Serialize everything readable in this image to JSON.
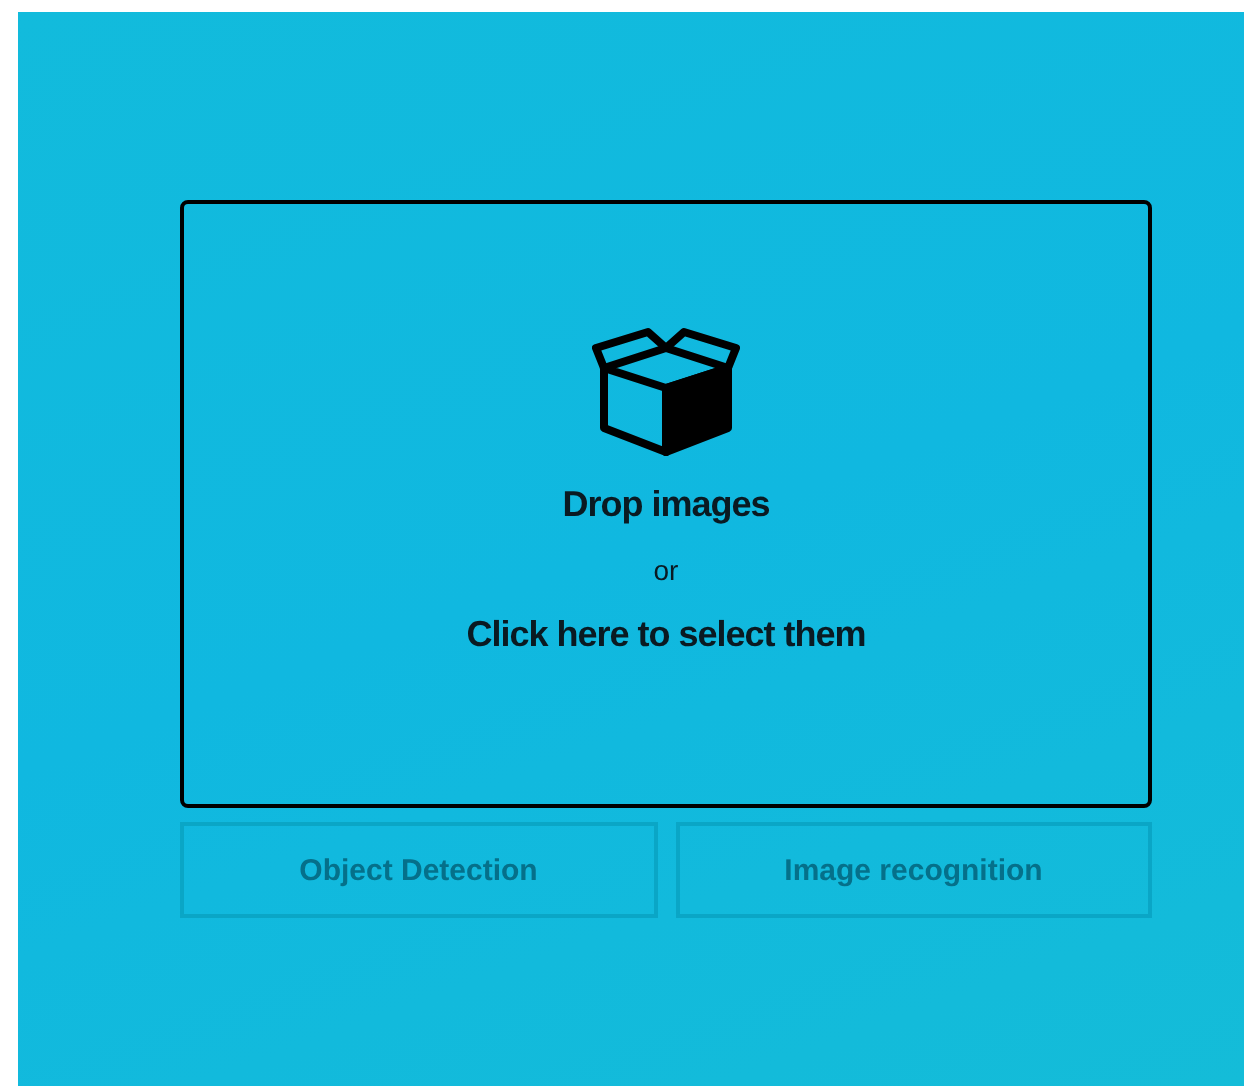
{
  "dropzone": {
    "title": "Drop images",
    "separator": "or",
    "action": "Click here to select them"
  },
  "buttons": [
    {
      "label": "Object Detection",
      "disabled": true
    },
    {
      "label": "Image recognition",
      "disabled": true
    }
  ]
}
